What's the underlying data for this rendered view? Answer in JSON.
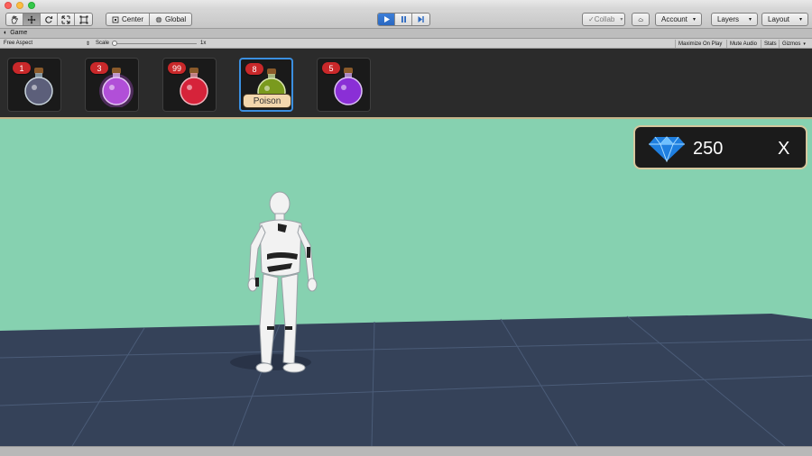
{
  "toolbar": {
    "tools": [
      {
        "icon": "hand-icon"
      },
      {
        "icon": "move-icon",
        "active": true
      },
      {
        "icon": "rotate-icon"
      },
      {
        "icon": "scale-icon"
      },
      {
        "icon": "rect-tool-icon"
      }
    ],
    "pivot_label": "Center",
    "space_label": "Global",
    "collab_label": "Collab",
    "account_label": "Account",
    "layers_label": "Layers",
    "layout_label": "Layout"
  },
  "game_tab": {
    "title": "Game",
    "aspect_label": "Free Aspect",
    "scale_label": "Scale",
    "scale_value": "1x",
    "maximize_label": "Maximize On Play",
    "mute_label": "Mute Audio",
    "stats_label": "Stats",
    "gizmos_label": "Gizmos"
  },
  "inventory": {
    "slots": [
      {
        "count": "1",
        "potion_color": "#5c5f7a",
        "glow": false
      },
      {
        "count": "3",
        "potion_color": "#b14fd8",
        "glow": true
      },
      {
        "count": "99",
        "potion_color": "#d6233a",
        "glow": false
      },
      {
        "count": "8",
        "potion_color": "#7a9a1e",
        "glow": false,
        "selected": true,
        "tooltip": "Poison"
      },
      {
        "count": "5",
        "potion_color": "#8a2fd6",
        "glow": false
      }
    ]
  },
  "currency": {
    "amount": "250",
    "close_label": "X",
    "icon": "diamond-icon"
  },
  "colors": {
    "sky": "#86d1b0",
    "floor": "#354259",
    "badge": "#c9282a",
    "selection": "#3b8fe0",
    "panel_border": "#d6c79e"
  }
}
